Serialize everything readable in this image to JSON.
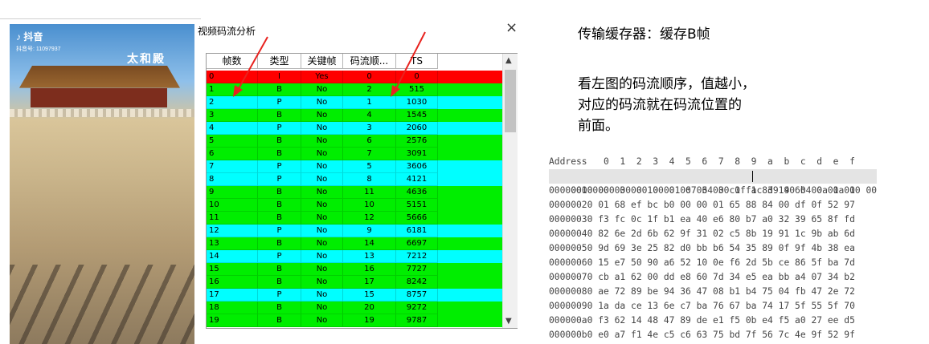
{
  "photo": {
    "app_logo": "抖音",
    "account_id": "抖音号: 11097937",
    "plaque": "太和殿"
  },
  "window": {
    "title": "视频码流分析",
    "close_glyph": "×",
    "columns": [
      "帧数",
      "类型",
      "关键帧",
      "码流顺...",
      "TS"
    ],
    "rows": [
      {
        "frame": "0",
        "type": "I",
        "key": "Yes",
        "order": "0",
        "ts": "0"
      },
      {
        "frame": "1",
        "type": "B",
        "key": "No",
        "order": "2",
        "ts": "515"
      },
      {
        "frame": "2",
        "type": "P",
        "key": "No",
        "order": "1",
        "ts": "1030"
      },
      {
        "frame": "3",
        "type": "B",
        "key": "No",
        "order": "4",
        "ts": "1545"
      },
      {
        "frame": "4",
        "type": "P",
        "key": "No",
        "order": "3",
        "ts": "2060"
      },
      {
        "frame": "5",
        "type": "B",
        "key": "No",
        "order": "6",
        "ts": "2576"
      },
      {
        "frame": "6",
        "type": "B",
        "key": "No",
        "order": "7",
        "ts": "3091"
      },
      {
        "frame": "7",
        "type": "P",
        "key": "No",
        "order": "5",
        "ts": "3606"
      },
      {
        "frame": "8",
        "type": "P",
        "key": "No",
        "order": "8",
        "ts": "4121"
      },
      {
        "frame": "9",
        "type": "B",
        "key": "No",
        "order": "11",
        "ts": "4636"
      },
      {
        "frame": "10",
        "type": "B",
        "key": "No",
        "order": "10",
        "ts": "5151"
      },
      {
        "frame": "11",
        "type": "B",
        "key": "No",
        "order": "12",
        "ts": "5666"
      },
      {
        "frame": "12",
        "type": "P",
        "key": "No",
        "order": "9",
        "ts": "6181"
      },
      {
        "frame": "13",
        "type": "B",
        "key": "No",
        "order": "14",
        "ts": "6697"
      },
      {
        "frame": "14",
        "type": "P",
        "key": "No",
        "order": "13",
        "ts": "7212"
      },
      {
        "frame": "15",
        "type": "B",
        "key": "No",
        "order": "16",
        "ts": "7727"
      },
      {
        "frame": "16",
        "type": "B",
        "key": "No",
        "order": "17",
        "ts": "8242"
      },
      {
        "frame": "17",
        "type": "P",
        "key": "No",
        "order": "15",
        "ts": "8757"
      },
      {
        "frame": "18",
        "type": "B",
        "key": "No",
        "order": "20",
        "ts": "9272"
      },
      {
        "frame": "19",
        "type": "B",
        "key": "No",
        "order": "19",
        "ts": "9787"
      }
    ],
    "colors": {
      "I": "#ff0000",
      "B": "#00ee00",
      "P": "#00ffff",
      "arrow": "#e8231f"
    }
  },
  "annotations": {
    "cache_label": "传输缓存器：缓存B帧",
    "note_lines": [
      "看左图的码流顺序，值越小，",
      "对应的码流就在码流位置的",
      "前面。"
    ]
  },
  "hex": {
    "header": "Address   0  1  2  3  4  5  6  7  8  9  a  b  c  d  e  f",
    "rows": [
      "00000000 00 00 00 01 67 64 00 1f ac d9 40 b4 0a 1a 10 00",
      "00000010 00 03 00 10 00 00 03 03 c0 f1 83 19 60 00 00 00",
      "00000020 01 68 ef bc b0 00 00 01 65 88 84 00 df 0f 52 97",
      "00000030 f3 fc 0c 1f b1 ea 40 e6 80 b7 a0 32 39 65 8f fd",
      "00000040 82 6e 2d 6b 62 9f 31 02 c5 8b 19 91 1c 9b ab 6d",
      "00000050 9d 69 3e 25 82 d0 bb b6 54 35 89 0f 9f 4b 38 ea",
      "00000060 15 e7 50 90 a6 52 10 0e f6 2d 5b ce 86 5f ba 7d",
      "00000070 cb a1 62 00 dd e8 60 7d 34 e5 ea bb a4 07 34 b2",
      "00000080 ae 72 89 be 94 36 47 08 b1 b4 75 04 fb 47 2e 72",
      "00000090 1a da ce 13 6e c7 ba 76 67 ba 74 17 5f 55 5f 70",
      "000000a0 f3 62 14 48 47 89 de e1 f5 0b e4 f5 a0 27 ee d5",
      "000000b0 e0 a7 f1 4e c5 c6 63 75 bd 7f 56 7c 4e 9f 52 9f"
    ]
  }
}
